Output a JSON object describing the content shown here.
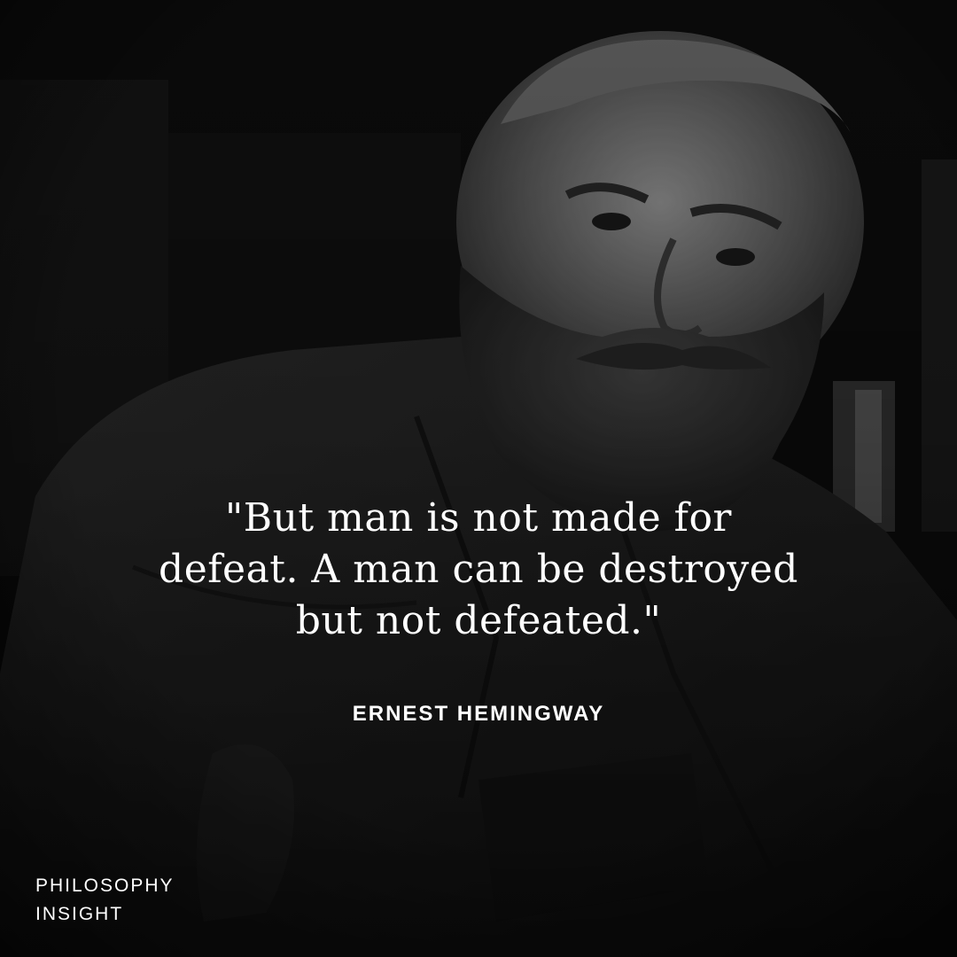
{
  "quote": {
    "lines": [
      "\"But man is not made for",
      "defeat. A man can be destroyed",
      "but not defeated.\""
    ]
  },
  "author": "ERNEST HEMINGWAY",
  "brand": {
    "line1": "PHILOSOPHY",
    "line2": "INSIGHT"
  },
  "colors": {
    "background": "#0c0c0c",
    "text": "#ffffff"
  }
}
